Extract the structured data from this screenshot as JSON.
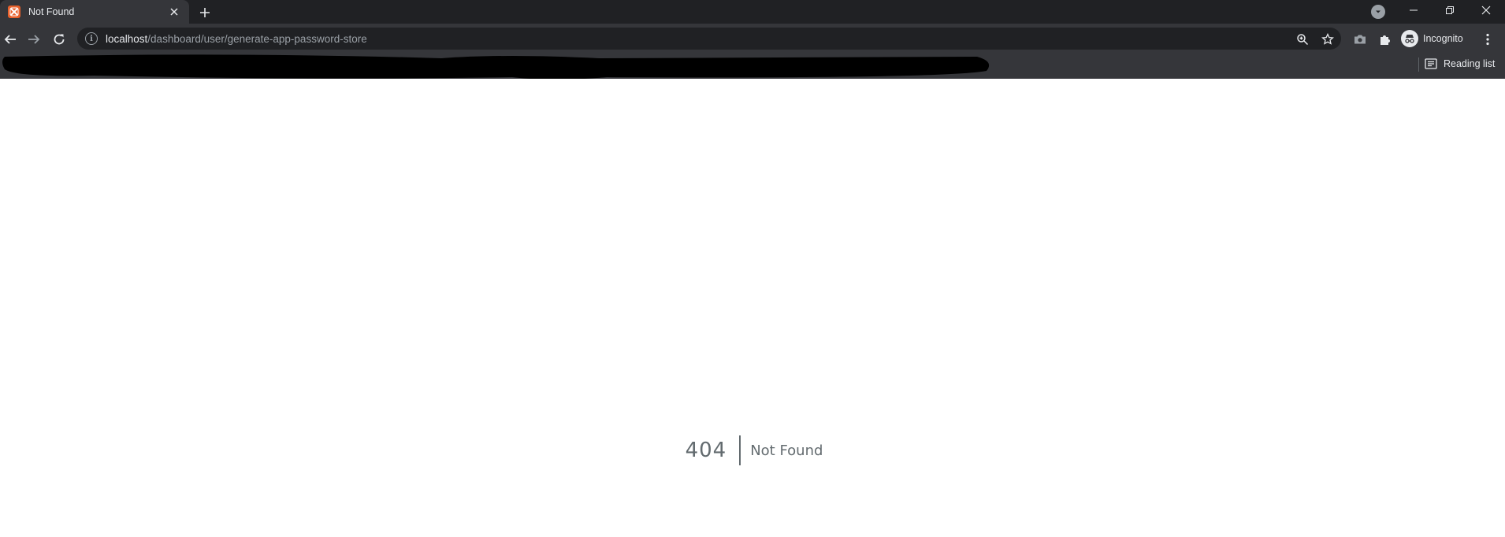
{
  "tab": {
    "title": "Not Found",
    "favicon": "xampp-icon"
  },
  "address_bar": {
    "host": "localhost",
    "path": "/dashboard/user/generate-app-password-store"
  },
  "toolbar": {
    "profile_label": "Incognito"
  },
  "bookmarks": {
    "reading_list_label": "Reading list"
  },
  "page": {
    "error_code": "404",
    "error_message": "Not Found"
  },
  "colors": {
    "chrome_dark": "#202124",
    "chrome_toolbar": "#35363a",
    "error_text": "#636b6f",
    "favicon": "#e8612c"
  }
}
